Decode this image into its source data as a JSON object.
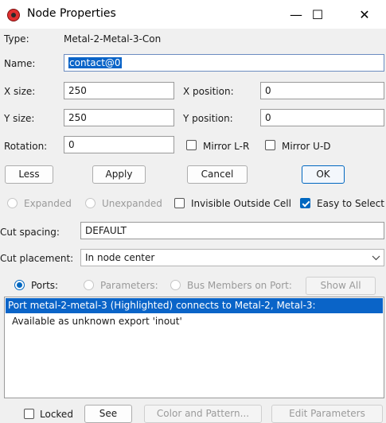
{
  "window": {
    "title": "Node Properties",
    "minimize_glyph": "—",
    "maximize_glyph": "☐",
    "close_glyph": "✕"
  },
  "type": {
    "label": "Type:",
    "value": "Metal-2-Metal-3-Con"
  },
  "name": {
    "label": "Name:",
    "value": "contact@0"
  },
  "xsize": {
    "label": "X size:",
    "value": "250"
  },
  "ysize": {
    "label": "Y size:",
    "value": "250"
  },
  "xpos": {
    "label": "X position:",
    "value": "0"
  },
  "ypos": {
    "label": "Y position:",
    "value": "0"
  },
  "rotation": {
    "label": "Rotation:",
    "value": "0"
  },
  "mirror_lr": {
    "label": "Mirror L-R",
    "checked": false
  },
  "mirror_ud": {
    "label": "Mirror U-D",
    "checked": false
  },
  "buttons": {
    "less": "Less",
    "apply": "Apply",
    "cancel": "Cancel",
    "ok": "OK"
  },
  "expanded": {
    "label": "Expanded",
    "checked": false,
    "enabled": false
  },
  "unexpanded": {
    "label": "Unexpanded",
    "checked": false,
    "enabled": false
  },
  "invisible_outside": {
    "label": "Invisible Outside Cell",
    "checked": false
  },
  "easy_select": {
    "label": "Easy to Select",
    "checked": true
  },
  "cut_spacing": {
    "label": "Cut spacing:",
    "value": "DEFAULT"
  },
  "cut_placement": {
    "label": "Cut placement:",
    "value": "In node center"
  },
  "view": {
    "ports": "Ports:",
    "parameters": "Parameters:",
    "bus_members": "Bus Members on Port:",
    "show_all": "Show All",
    "selected": "ports"
  },
  "list": {
    "items": [
      "Port metal-2-metal-3 (Highlighted) connects to Metal-2, Metal-3:",
      "Available as unknown export 'inout'"
    ],
    "selected_index": 0
  },
  "footer": {
    "locked": "Locked",
    "see": "See",
    "color_pattern": "Color and Pattern...",
    "edit_params": "Edit Parameters"
  },
  "colors": {
    "accent": "#0067c0",
    "selection": "#0a64c8",
    "app_icon": "#e03030"
  },
  "icons": {
    "app": "app-node-icon",
    "dropdown": "chevron-down-icon"
  }
}
